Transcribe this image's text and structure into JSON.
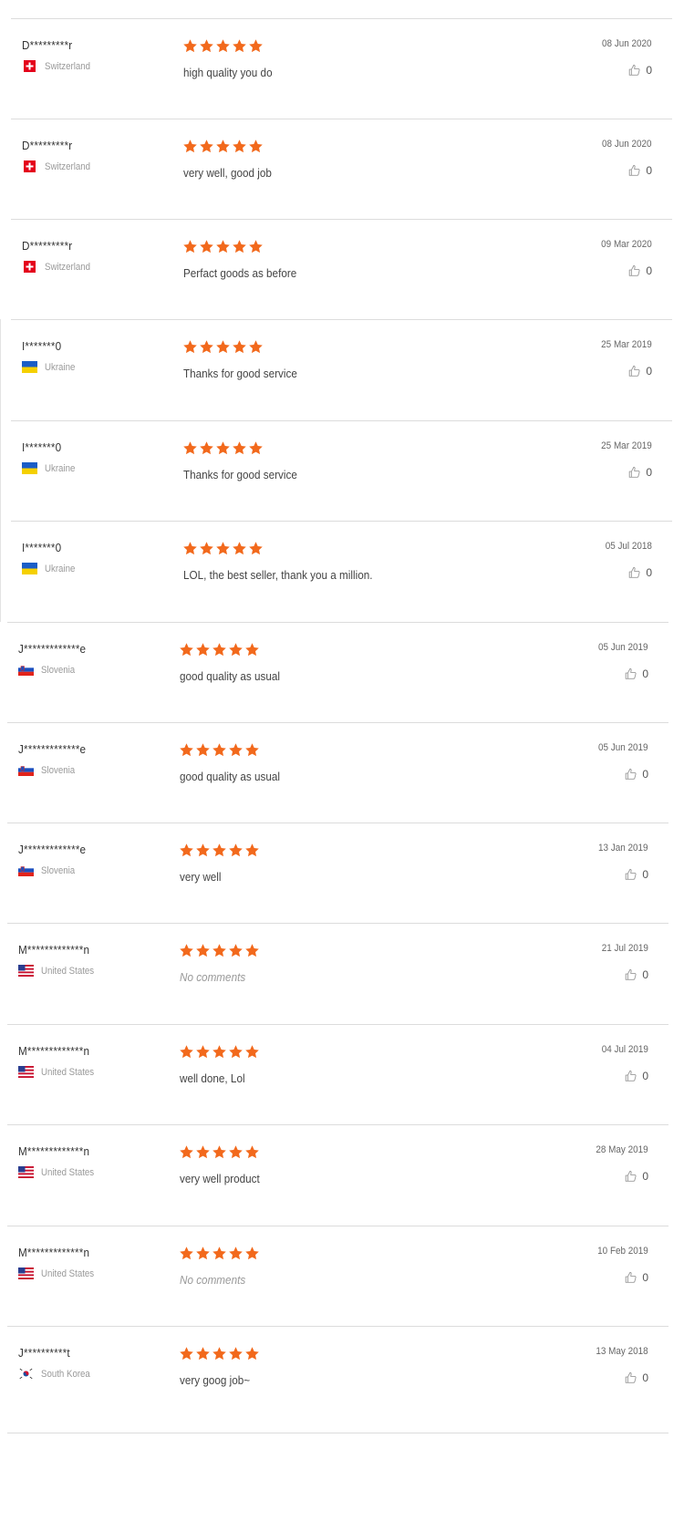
{
  "accent": "#f2691c",
  "reviews": [
    {
      "name": "D*********r",
      "country": "Switzerland",
      "flag": "switzerland",
      "rating": 5,
      "comment": "high quality you do",
      "date": "08 Jun 2020",
      "likes": "0"
    },
    {
      "name": "D*********r",
      "country": "Switzerland",
      "flag": "switzerland",
      "rating": 5,
      "comment": "very well, good job",
      "date": "08 Jun 2020",
      "likes": "0"
    },
    {
      "name": "D*********r",
      "country": "Switzerland",
      "flag": "switzerland",
      "rating": 5,
      "comment": "Perfact goods as before",
      "date": "09 Mar 2020",
      "likes": "0"
    },
    {
      "name": "I*******0",
      "country": "Ukraine",
      "flag": "ukraine",
      "rating": 5,
      "comment": "Thanks for good service",
      "date": "25 Mar 2019",
      "likes": "0"
    },
    {
      "name": "I*******0",
      "country": "Ukraine",
      "flag": "ukraine",
      "rating": 5,
      "comment": "Thanks for good service",
      "date": "25 Mar 2019",
      "likes": "0"
    },
    {
      "name": "I*******0",
      "country": "Ukraine",
      "flag": "ukraine",
      "rating": 5,
      "comment": "LOL, the best seller, thank you a million.",
      "date": "05 Jul 2018",
      "likes": "0"
    },
    {
      "name": "J*************e",
      "country": "Slovenia",
      "flag": "slovenia",
      "rating": 5,
      "comment": "good quality as usual",
      "date": "05 Jun 2019",
      "likes": "0"
    },
    {
      "name": "J*************e",
      "country": "Slovenia",
      "flag": "slovenia",
      "rating": 5,
      "comment": "good quality as usual",
      "date": "05 Jun 2019",
      "likes": "0"
    },
    {
      "name": "J*************e",
      "country": "Slovenia",
      "flag": "slovenia",
      "rating": 5,
      "comment": "very well",
      "date": "13 Jan 2019",
      "likes": "0"
    },
    {
      "name": "M*************n",
      "country": "United States",
      "flag": "usa",
      "rating": 5,
      "comment": "No comments",
      "no_comment": true,
      "date": "21 Jul 2019",
      "likes": "0"
    },
    {
      "name": "M*************n",
      "country": "United States",
      "flag": "usa",
      "rating": 5,
      "comment": "well done, Lol",
      "date": "04 Jul 2019",
      "likes": "0"
    },
    {
      "name": "M*************n",
      "country": "United States",
      "flag": "usa",
      "rating": 5,
      "comment": "very well product",
      "date": "28 May 2019",
      "likes": "0"
    },
    {
      "name": "M*************n",
      "country": "United States",
      "flag": "usa",
      "rating": 5,
      "comment": "No comments",
      "no_comment": true,
      "date": "10 Feb 2019",
      "likes": "0"
    },
    {
      "name": "J**********t",
      "country": "South Korea",
      "flag": "south-korea",
      "rating": 5,
      "comment": "very goog job~",
      "date": "13 May 2018",
      "likes": "0"
    }
  ]
}
